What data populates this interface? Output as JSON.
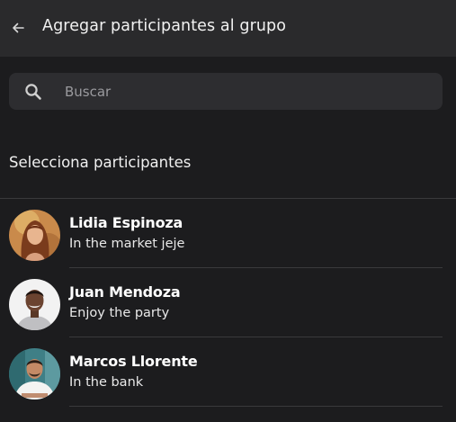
{
  "header": {
    "title": "Agregar participantes al grupo",
    "back_icon": "arrow-left-icon"
  },
  "search": {
    "placeholder": "Buscar",
    "value": "",
    "icon": "search-icon"
  },
  "section": {
    "title": "Selecciona participantes"
  },
  "contacts": [
    {
      "name": "Lidia Espinoza",
      "status": "In the market jeje"
    },
    {
      "name": "Juan Mendoza",
      "status": "Enjoy the party"
    },
    {
      "name": "Marcos Llorente",
      "status": "In the bank"
    }
  ],
  "colors": {
    "background": "#1c1c1e",
    "topbar": "#2a2a2c",
    "search_bg": "#2d2d30",
    "divider": "#3a3a3c"
  }
}
